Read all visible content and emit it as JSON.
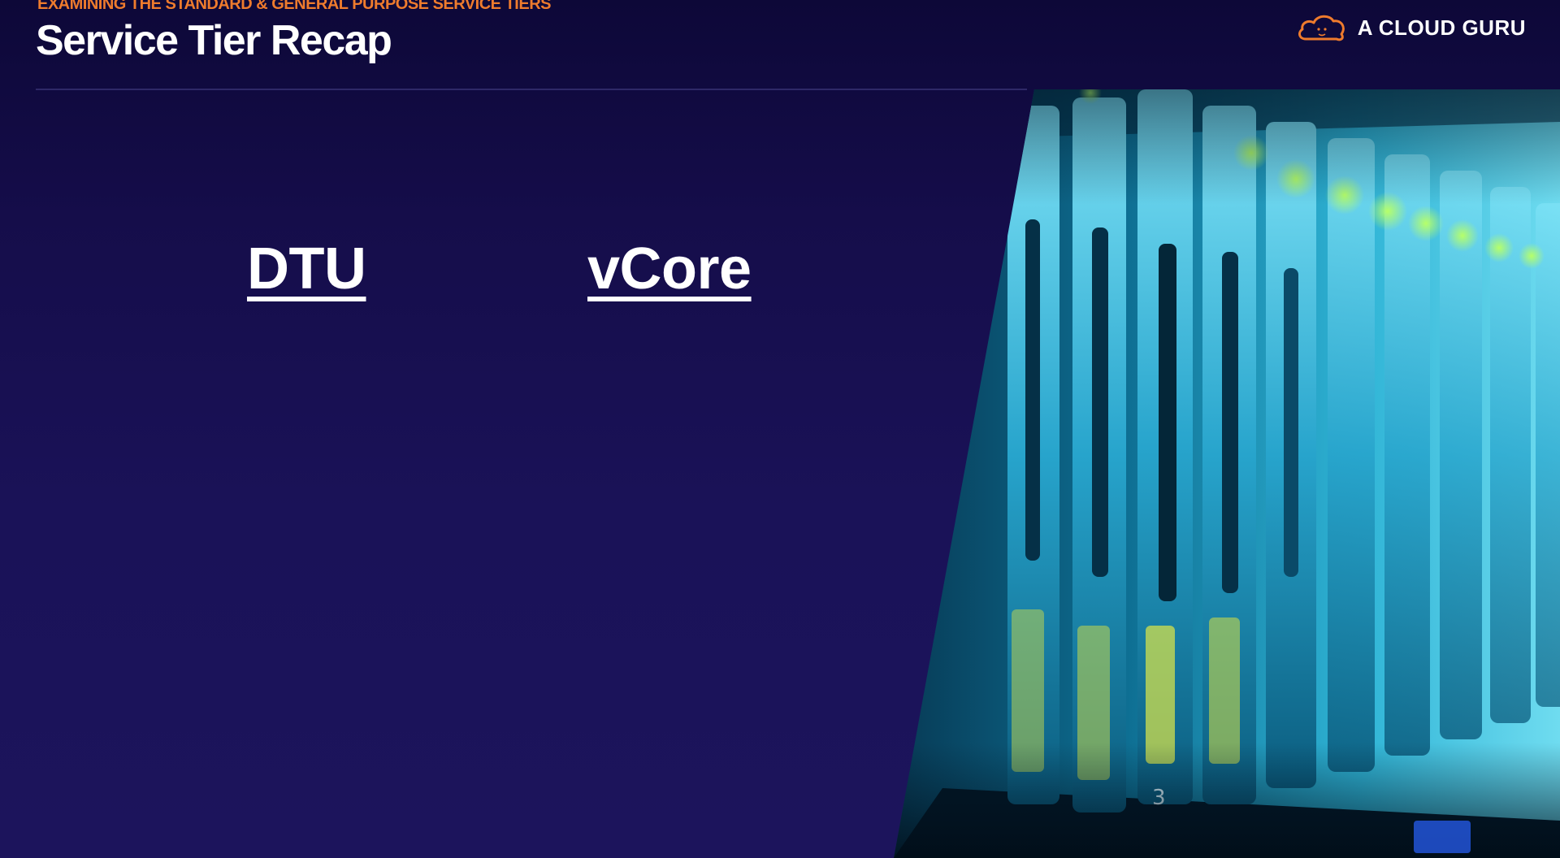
{
  "header": {
    "kicker": "EXAMINING THE STANDARD & GENERAL PURPOSE SERVICE TIERS",
    "title": "Service Tier Recap"
  },
  "brand": {
    "logo_text": "A CLOUD GURU",
    "logo_icon": "cloud-icon",
    "accent_color": "#ee7b2d"
  },
  "tiers": [
    {
      "label": "DTU"
    },
    {
      "label": "vCore"
    }
  ],
  "photo": {
    "subject": "server-rack-image",
    "bay_number": "3"
  },
  "colors": {
    "background": "#1a1258",
    "text": "#ffffff",
    "divider": "#2e2867"
  }
}
